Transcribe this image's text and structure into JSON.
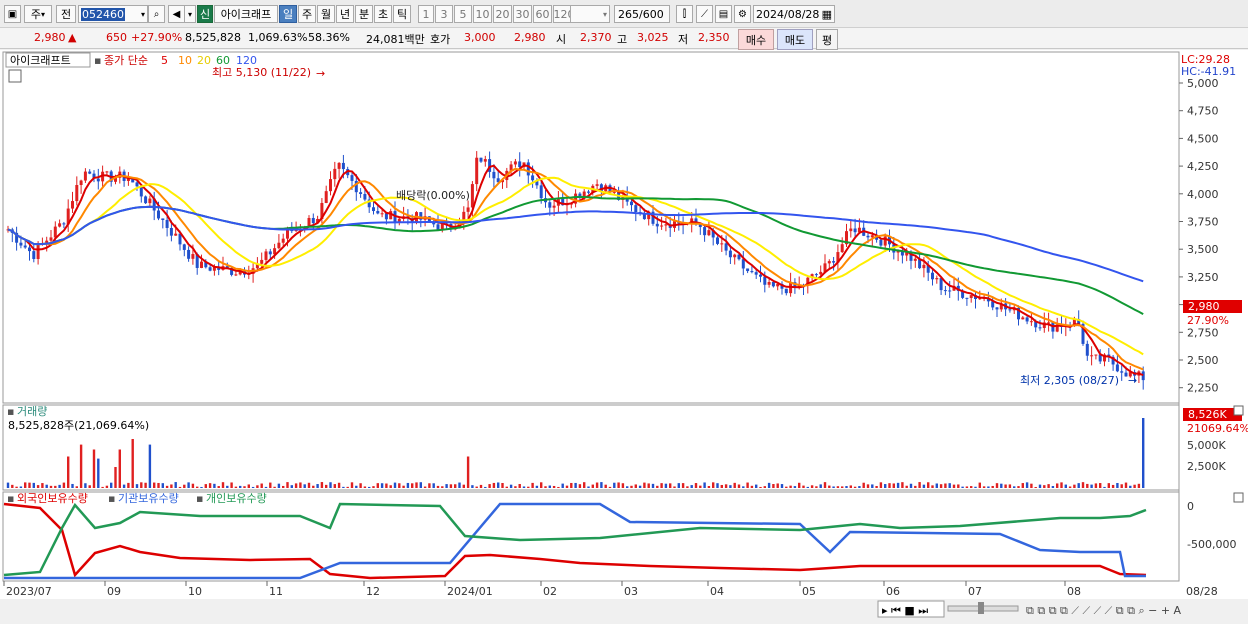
{
  "toolbar": {
    "period_left": "주",
    "period_prev": "전",
    "code": "052460",
    "badge": "신",
    "stock_name": "아이크래프",
    "intervals": [
      "일",
      "주",
      "월",
      "년",
      "분",
      "초",
      "틱"
    ],
    "minutes": [
      "1",
      "3",
      "5",
      "10",
      "20",
      "30",
      "60",
      "120"
    ],
    "count": "265",
    "count_total": "/600",
    "date": "2024/08/28"
  },
  "quotes": {
    "price": "2,980",
    "arrow": "▲",
    "change": "650",
    "change_pct": "+27.90%",
    "volume": "8,525,828",
    "volume_ratio": "1,069.63%",
    "turnover": "58.36%",
    "amount": "24,081백만",
    "ask_label": "호가",
    "ask": "3,000",
    "bid": "2,980",
    "open_label": "시",
    "open": "2,370",
    "high_label": "고",
    "high": "3,025",
    "low_label": "저",
    "low": "2,350",
    "buy_label": "매수",
    "sell_label": "매도",
    "avg_label": "평"
  },
  "price_panel": {
    "name": "아이크래프트",
    "indicator": "종가 단순",
    "ma_labels": [
      "5",
      "10",
      "20",
      "60",
      "120"
    ],
    "ma_colors": [
      "#dd0000",
      "#ff8800",
      "#ffee00",
      "#119933",
      "#3355ee"
    ],
    "lc": "LC:29.28",
    "hc": "HC:-41.91",
    "annotation_high": "최고 5,130 (11/22)",
    "annotation_low": "최저 2,305 (08/27)",
    "annotation_div": "배당락(0.00%)",
    "current_price": "2,980",
    "current_pct": "27.90%",
    "yticks": [
      "5,000",
      "4,750",
      "4,500",
      "4,250",
      "4,000",
      "3,750",
      "3,500",
      "3,250",
      "3,000",
      "2,750",
      "2,500",
      "2,250"
    ]
  },
  "volume_panel": {
    "title": "거래량",
    "value": "8,525,828주(21,069.64%)",
    "current": "8,526K",
    "current_pct": "21069.64%",
    "yticks": [
      "5,000K",
      "2,500K"
    ]
  },
  "holding_panel": {
    "legend": [
      "외국인보유수량",
      "기관보유수량",
      "개인보유수량"
    ],
    "colors": [
      "#dd0000",
      "#3366dd",
      "#229955"
    ],
    "yticks": [
      "0",
      "-500,000"
    ]
  },
  "x_axis": {
    "labels": [
      "2023/07",
      "09",
      "10",
      "11",
      "12",
      "2024/01",
      "02",
      "03",
      "04",
      "05",
      "06",
      "07",
      "08"
    ],
    "current": "08/28"
  }
}
